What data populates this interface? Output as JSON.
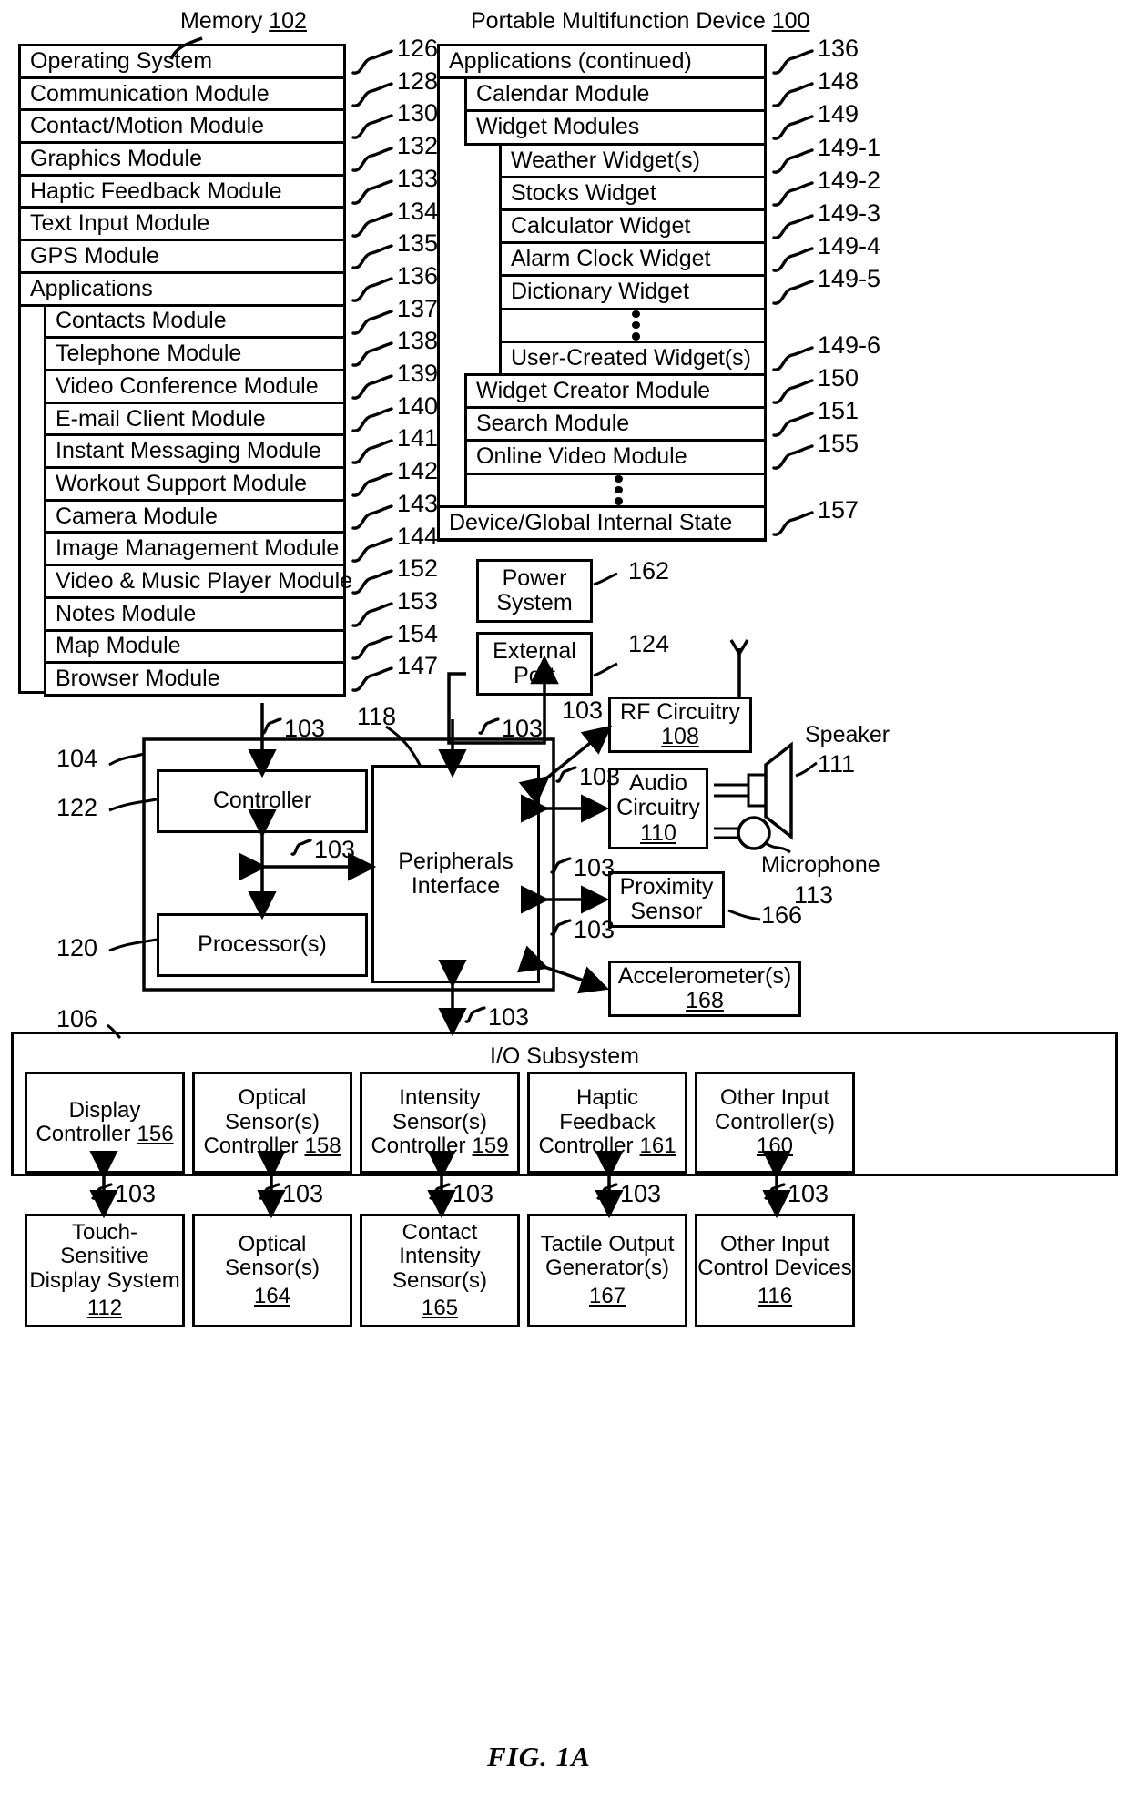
{
  "figure": {
    "label": "FIG. 1A",
    "memory_title": "Memory",
    "memory_title_num": "102",
    "device_title": "Portable Multifunction Device",
    "device_title_num": "100"
  },
  "memory_column": {
    "items": [
      {
        "label": "Operating System",
        "ref": "126",
        "indent": 0
      },
      {
        "label": "Communication Module",
        "ref": "128",
        "indent": 0
      },
      {
        "label": "Contact/Motion Module",
        "ref": "130",
        "indent": 0
      },
      {
        "label": "Graphics Module",
        "ref": "132",
        "indent": 0
      },
      {
        "label": "Haptic Feedback Module",
        "ref": "133",
        "indent": 0
      },
      {
        "label": "Text Input Module",
        "ref": "134",
        "indent": 0
      },
      {
        "label": "GPS Module",
        "ref": "135",
        "indent": 0
      },
      {
        "label": "Applications",
        "ref": "136",
        "indent": 0
      },
      {
        "label": "Contacts Module",
        "ref": "137",
        "indent": 1
      },
      {
        "label": "Telephone Module",
        "ref": "138",
        "indent": 1
      },
      {
        "label": "Video Conference Module",
        "ref": "139",
        "indent": 1
      },
      {
        "label": "E-mail Client Module",
        "ref": "140",
        "indent": 1
      },
      {
        "label": "Instant Messaging Module",
        "ref": "141",
        "indent": 1
      },
      {
        "label": "Workout Support Module",
        "ref": "142",
        "indent": 1
      },
      {
        "label": "Camera Module",
        "ref": "143",
        "indent": 1
      },
      {
        "label": "Image Management Module",
        "ref": "144",
        "indent": 1
      },
      {
        "label": "Video & Music Player Module",
        "ref": "152",
        "indent": 1
      },
      {
        "label": "Notes Module",
        "ref": "153",
        "indent": 1
      },
      {
        "label": "Map Module",
        "ref": "154",
        "indent": 1
      },
      {
        "label": "Browser Module",
        "ref": "147",
        "indent": 1
      }
    ]
  },
  "device_column": {
    "items": [
      {
        "label": "Applications (continued)",
        "ref": "136",
        "indent": 0,
        "dots": false
      },
      {
        "label": "Calendar Module",
        "ref": "148",
        "indent": 1,
        "dots": false
      },
      {
        "label": "Widget Modules",
        "ref": "149",
        "indent": 1,
        "dots": false
      },
      {
        "label": "Weather Widget(s)",
        "ref": "149-1",
        "indent": 2,
        "dots": false
      },
      {
        "label": "Stocks Widget",
        "ref": "149-2",
        "indent": 2,
        "dots": false
      },
      {
        "label": "Calculator Widget",
        "ref": "149-3",
        "indent": 2,
        "dots": false
      },
      {
        "label": "Alarm Clock Widget",
        "ref": "149-4",
        "indent": 2,
        "dots": false
      },
      {
        "label": "Dictionary Widget",
        "ref": "149-5",
        "indent": 2,
        "dots": false
      },
      {
        "label": "",
        "ref": "",
        "indent": 2,
        "dots": true
      },
      {
        "label": "User-Created Widget(s)",
        "ref": "149-6",
        "indent": 2,
        "dots": false
      },
      {
        "label": "Widget Creator Module",
        "ref": "150",
        "indent": 1,
        "dots": false
      },
      {
        "label": "Search Module",
        "ref": "151",
        "indent": 1,
        "dots": false
      },
      {
        "label": "Online Video Module",
        "ref": "155",
        "indent": 1,
        "dots": false
      },
      {
        "label": "",
        "ref": "",
        "indent": 1,
        "dots": true
      },
      {
        "label": "Device/Global Internal State",
        "ref": "157",
        "indent": 0,
        "dots": false
      }
    ]
  },
  "core": {
    "controller_label": "Controller",
    "controller_ref": "122",
    "processor_label": "Processor(s)",
    "processor_ref": "120",
    "peripherals_label_line1": "Peripherals",
    "peripherals_label_line2": "Interface",
    "peripherals_ref": "118",
    "outer_ref": "104",
    "bus_ref": "103"
  },
  "peripherals": [
    {
      "name": "power-system",
      "line1": "Power",
      "line2": "System",
      "ref": "162",
      "num": ""
    },
    {
      "name": "external-port",
      "line1": "External",
      "line2": "Port",
      "ref": "124",
      "num": ""
    },
    {
      "name": "rf-circuitry",
      "line1": "RF Circuitry",
      "line2": "",
      "ref": "",
      "num": "108"
    },
    {
      "name": "audio-circuitry",
      "line1": "Audio",
      "line2": "Circuitry",
      "ref": "",
      "num": "110"
    },
    {
      "name": "proximity-sensor",
      "line1": "Proximity",
      "line2": "Sensor",
      "ref": "166",
      "num": ""
    },
    {
      "name": "accelerometers",
      "line1": "Accelerometer(s)",
      "line2": "",
      "ref": "",
      "num": "168"
    }
  ],
  "transducers": {
    "speaker_label": "Speaker",
    "speaker_ref": "111",
    "microphone_label": "Microphone",
    "microphone_ref": "113"
  },
  "io_subsystem": {
    "title": "I/O Subsystem",
    "ref": "106",
    "controllers": [
      {
        "line1": "Display",
        "line2": "Controller",
        "num": "156",
        "inline": true
      },
      {
        "line1": "Optical",
        "line2": "Sensor(s)",
        "line3": "Controller",
        "num": "158",
        "inline": true
      },
      {
        "line1": "Intensity",
        "line2": "Sensor(s)",
        "line3": "Controller",
        "num": "159",
        "inline": true
      },
      {
        "line1": "Haptic",
        "line2": "Feedback",
        "line3": "Controller",
        "num": "161",
        "inline": true
      },
      {
        "line1": "Other Input",
        "line2": "Controller(s)",
        "num": "160",
        "inline": false
      }
    ]
  },
  "devices": [
    {
      "lines": [
        "Touch-",
        "Sensitive",
        "Display System"
      ],
      "num": "112"
    },
    {
      "lines": [
        "Optical",
        "Sensor(s)"
      ],
      "num": "164"
    },
    {
      "lines": [
        "Contact",
        "Intensity",
        "Sensor(s)"
      ],
      "num": "165"
    },
    {
      "lines": [
        "Tactile Output",
        "Generator(s)"
      ],
      "num": "167"
    },
    {
      "lines": [
        "Other Input",
        "Control Devices"
      ],
      "num": "116"
    }
  ],
  "bus_labels": {
    "label": "103",
    "count_middle": 8,
    "count_io_top": 5,
    "count_io_bottom": 5
  }
}
